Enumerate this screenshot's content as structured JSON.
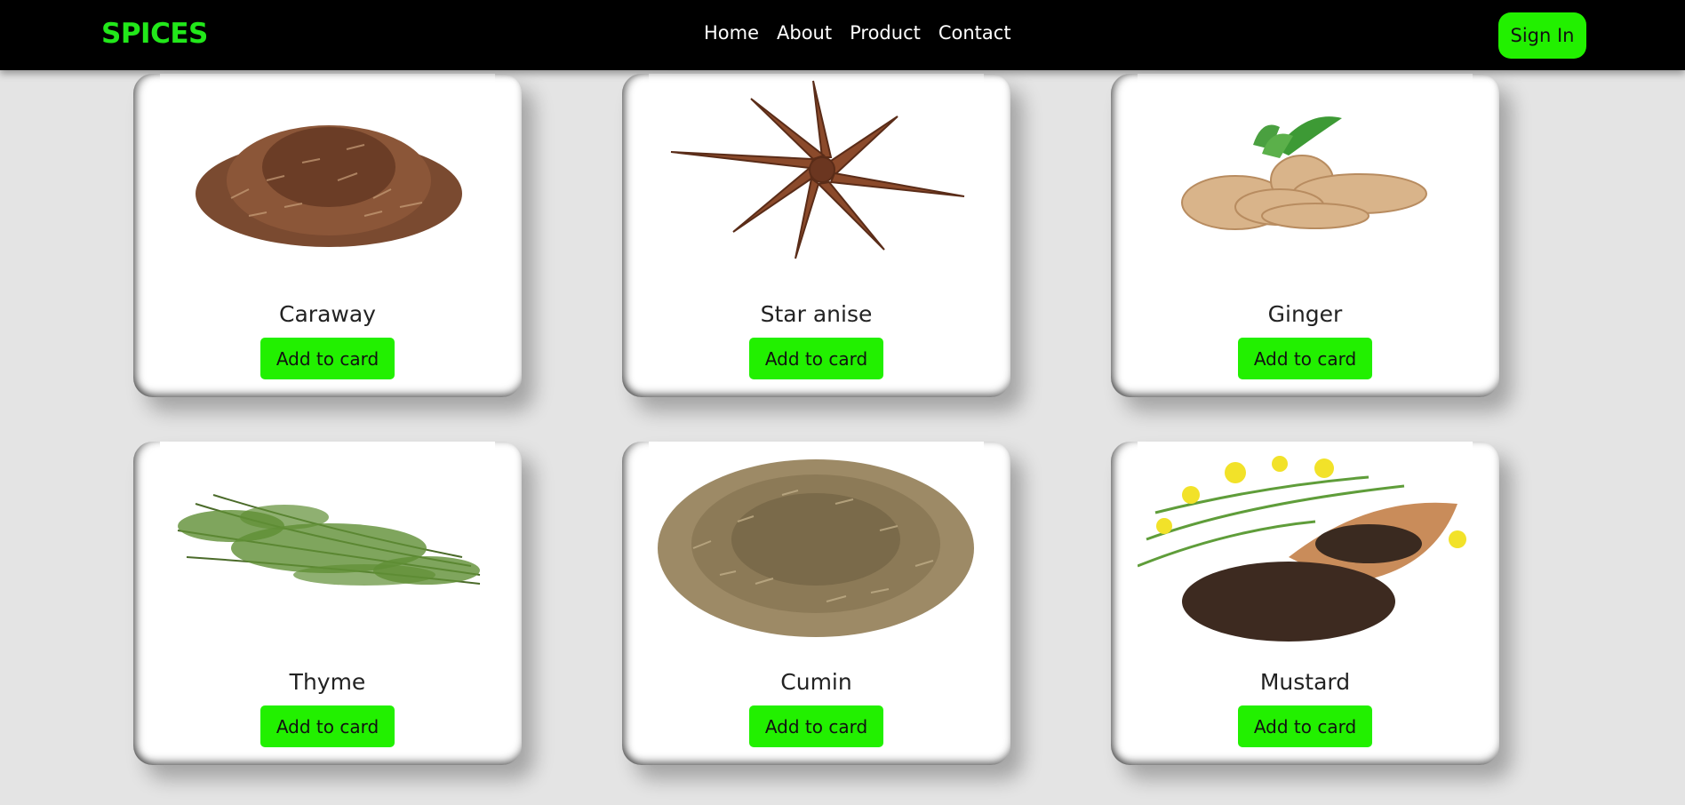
{
  "nav": {
    "logo": "SPICES",
    "links": [
      "Home",
      "About",
      "Product",
      "Contact"
    ],
    "signin_label": "Sign In"
  },
  "products": [
    {
      "name": "Caraway",
      "button": "Add to card",
      "image": "caraway-seeds-image"
    },
    {
      "name": "Star anise",
      "button": "Add to card",
      "image": "star-anise-image"
    },
    {
      "name": "Ginger",
      "button": "Add to card",
      "image": "ginger-root-image"
    },
    {
      "name": "Thyme",
      "button": "Add to card",
      "image": "thyme-sprigs-image"
    },
    {
      "name": "Cumin",
      "button": "Add to card",
      "image": "cumin-seeds-image"
    },
    {
      "name": "Mustard",
      "button": "Add to card",
      "image": "mustard-seeds-image"
    }
  ],
  "colors": {
    "accent": "#22f000",
    "logo": "#22e81a",
    "navbar": "#000000",
    "background": "#e4e4e4"
  }
}
